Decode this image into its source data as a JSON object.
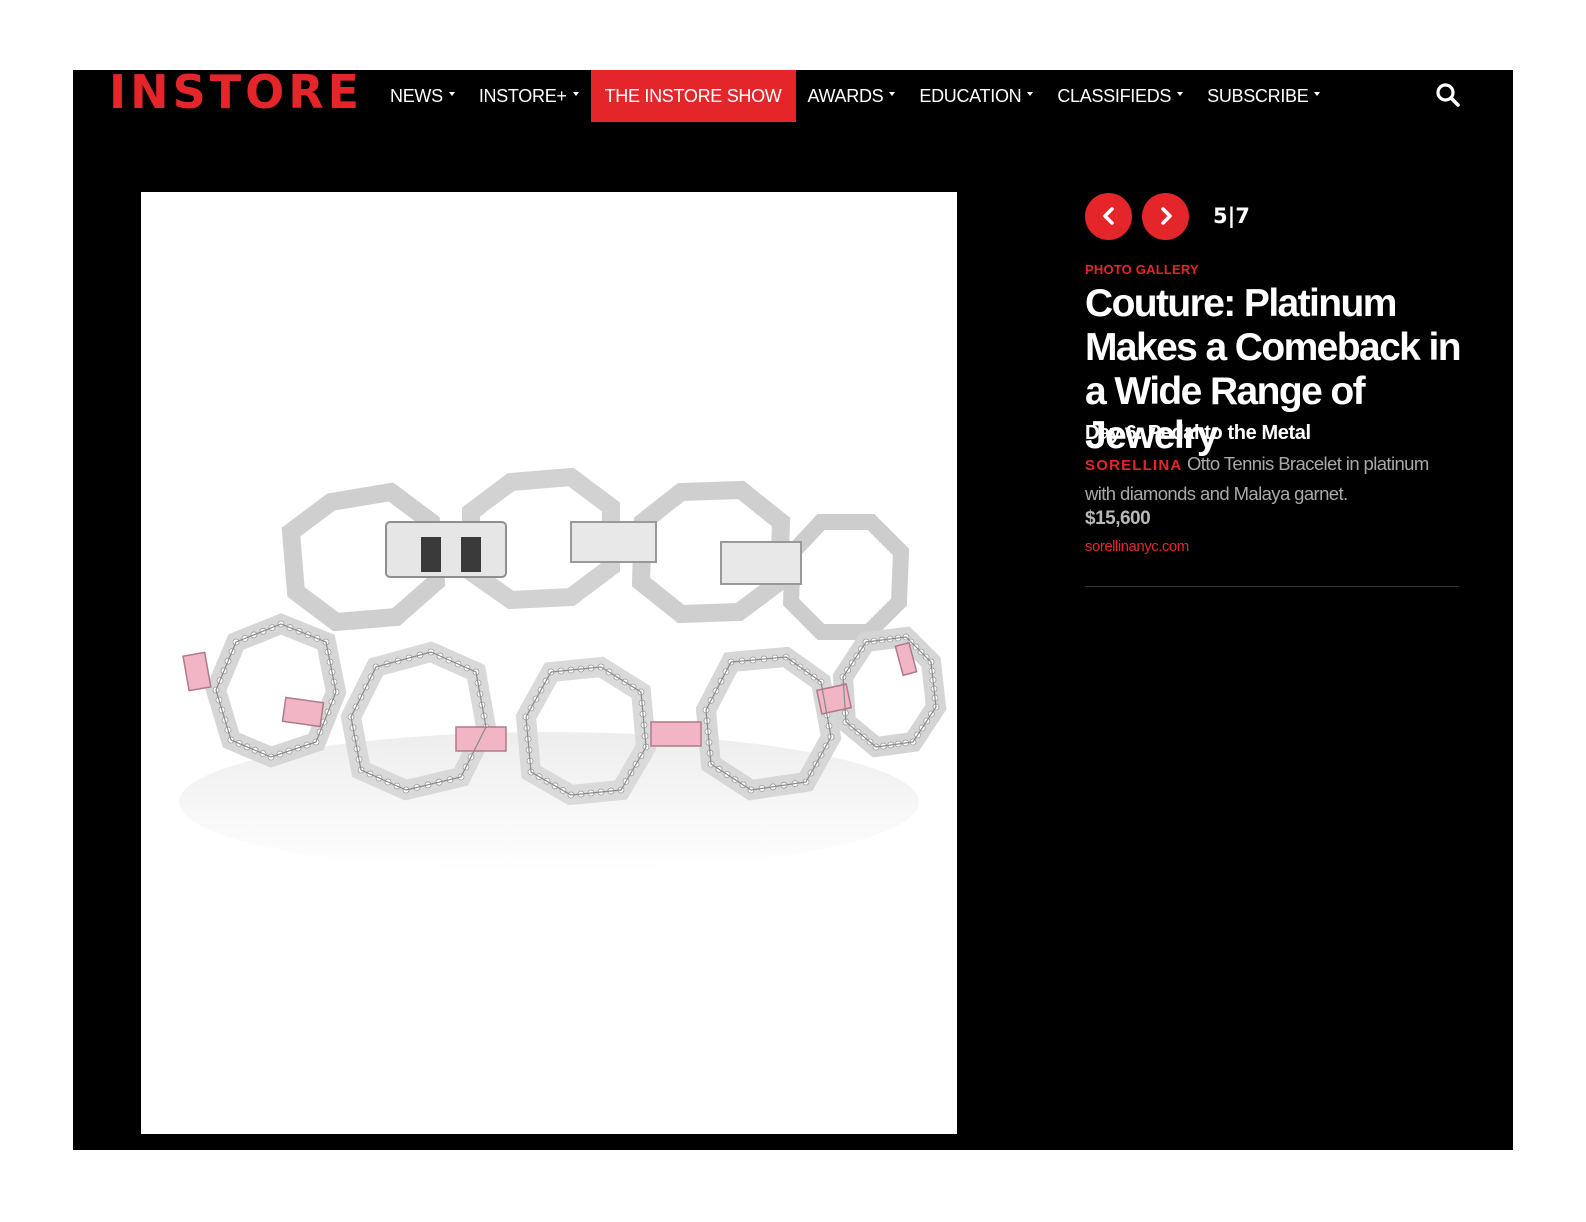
{
  "brand": {
    "logo_text": "INSTORE",
    "accent": "#e4262b"
  },
  "nav": {
    "items": [
      {
        "label": "NEWS",
        "dropdown": true
      },
      {
        "label": "INSTORE+",
        "dropdown": true
      },
      {
        "label": "THE INSTORE SHOW",
        "dropdown": false,
        "active": true
      },
      {
        "label": "AWARDS",
        "dropdown": true
      },
      {
        "label": "EDUCATION",
        "dropdown": true
      },
      {
        "label": "CLASSIFIEDS",
        "dropdown": true
      },
      {
        "label": "SUBSCRIBE",
        "dropdown": true
      }
    ],
    "search_icon": "search-icon"
  },
  "gallery": {
    "current": "5",
    "separator": "|",
    "total": "7",
    "prev_icon": "chevron-left-icon",
    "next_icon": "chevron-right-icon",
    "kicker": "PHOTO GALLERY",
    "title": "Couture: Platinum Makes a Comeback in a Wide Range of Jewelry",
    "subtitle": "Day 6: Pedal to the Metal",
    "item": {
      "brand": "SORELLINA",
      "description": "Otto Tennis Bracelet in platinum with diamonds and Malaya garnet.",
      "price": "$15,600",
      "website": "sorellinanyc.com"
    },
    "image": {
      "subject": "platinum octagon-link bracelet with diamonds and pink baguettes"
    }
  }
}
